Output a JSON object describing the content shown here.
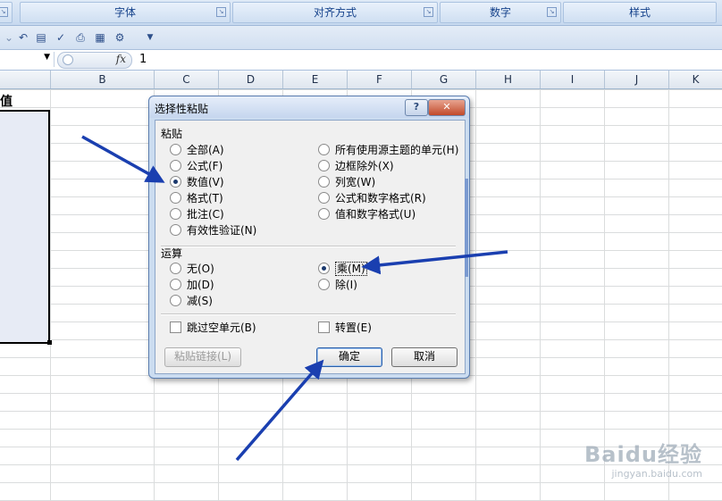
{
  "ribbon": {
    "groups": [
      "字体",
      "对齐方式",
      "数字",
      "样式"
    ]
  },
  "toolbar": {
    "icons": [
      "undo-icon",
      "form-icon",
      "spellcheck-icon",
      "print-preview-icon",
      "borders-icon",
      "tools-icon",
      "customize-icon"
    ]
  },
  "formula_bar": {
    "fx_label": "fx",
    "value": "1"
  },
  "columns": [
    "B",
    "C",
    "D",
    "E",
    "F",
    "G",
    "H",
    "I",
    "J",
    "K"
  ],
  "sheet": {
    "a1_value": "值"
  },
  "dialog": {
    "title": "选择性粘贴",
    "help_label": "?",
    "close_label": "✕",
    "paste_section": "粘贴",
    "paste_options_left": [
      "全部(A)",
      "公式(F)",
      "数值(V)",
      "格式(T)",
      "批注(C)",
      "有效性验证(N)"
    ],
    "paste_options_right": [
      "所有使用源主题的单元(H)",
      "边框除外(X)",
      "列宽(W)",
      "公式和数字格式(R)",
      "值和数字格式(U)"
    ],
    "paste_selected": "数值(V)",
    "operation_section": "运算",
    "operation_options_left": [
      "无(O)",
      "加(D)",
      "减(S)"
    ],
    "operation_options_right": [
      "乘(M)",
      "除(I)"
    ],
    "operation_selected": "乘(M)",
    "skip_blanks_label": "跳过空单元(B)",
    "transpose_label": "转置(E)",
    "paste_link_label": "粘贴链接(L)",
    "ok_label": "确定",
    "cancel_label": "取消"
  },
  "watermark": {
    "logo": "Baidu经验",
    "url": "jingyan.baidu.com"
  },
  "colors": {
    "arrow": "#1a3fb0",
    "ribbon": "#c7d9ef",
    "dialog_frame": "#cbdcf0"
  }
}
